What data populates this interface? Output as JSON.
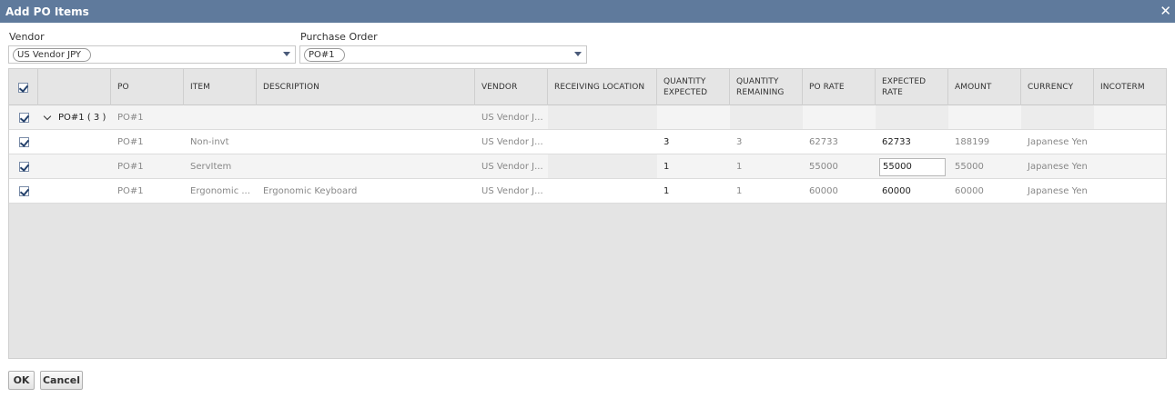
{
  "dialog": {
    "title": "Add PO Items",
    "close_glyph": "✕"
  },
  "vendor": {
    "label": "Vendor",
    "value": "US Vendor JPY"
  },
  "purchase_order": {
    "label": "Purchase Order",
    "value": "PO#1"
  },
  "columns": [
    "PO",
    "ITEM",
    "DESCRIPTION",
    "VENDOR",
    "RECEIVING LOCATION",
    "QUANTITY EXPECTED",
    "QUANTITY REMAINING",
    "PO RATE",
    "EXPECTED RATE",
    "AMOUNT",
    "CURRENCY",
    "INCOTERM"
  ],
  "group_row": {
    "label": "PO#1 ( 3 )",
    "po": "PO#1",
    "vendor": "US Vendor J...",
    "checked": true
  },
  "rows": [
    {
      "po": "PO#1",
      "item": "Non-invt",
      "description": "",
      "vendor": "US Vendor J...",
      "receiving_location": "",
      "qty_expected": "3",
      "qty_remaining": "3",
      "po_rate": "62733",
      "expected_rate": "62733",
      "amount": "188199",
      "currency": "Japanese Yen",
      "incoterm": "",
      "checked": true
    },
    {
      "po": "PO#1",
      "item": "ServItem",
      "description": "",
      "vendor": "US Vendor J...",
      "receiving_location": "",
      "qty_expected": "1",
      "qty_remaining": "1",
      "po_rate": "55000",
      "expected_rate": "55000",
      "amount": "55000",
      "currency": "Japanese Yen",
      "incoterm": "",
      "checked": true
    },
    {
      "po": "PO#1",
      "item": "Ergonomic ...",
      "description": "Ergonomic Keyboard",
      "vendor": "US Vendor J...",
      "receiving_location": "",
      "qty_expected": "1",
      "qty_remaining": "1",
      "po_rate": "60000",
      "expected_rate": "60000",
      "amount": "60000",
      "currency": "Japanese Yen",
      "incoterm": "",
      "checked": true
    }
  ],
  "buttons": {
    "ok": "OK",
    "cancel": "Cancel"
  },
  "colors": {
    "titlebar": "#5f7a9c",
    "grid_background": "#e4e4e4",
    "checkbox_mark": "#24416b"
  }
}
